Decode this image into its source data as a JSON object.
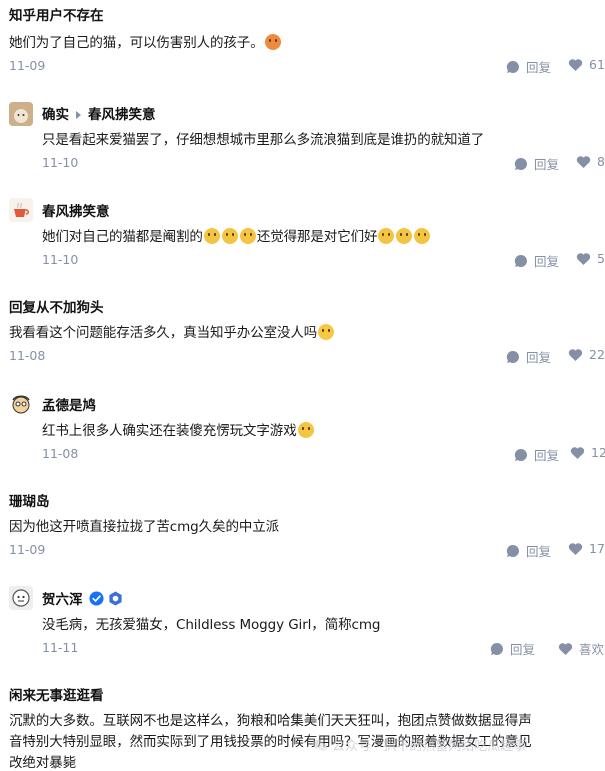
{
  "comments": [
    {
      "author": "知乎用户不存在",
      "text": "她们为了自己的猫，可以伤害别人的孩子。",
      "date": "11-09",
      "reply_label": "回复",
      "likes": "61"
    },
    {
      "author": "确实",
      "reply_to": "春风拂笑意",
      "text": "只是看起来爱猫罢了，仔细想想城市里那么多流浪猫到底是谁扔的就知道了",
      "date": "11-10",
      "reply_label": "回复",
      "likes": "8"
    },
    {
      "author": "春风拂笑意",
      "text_pre": "她们对自己的猫都是阉割的",
      "text_post": "还觉得那是对它们好",
      "date": "11-10",
      "reply_label": "回复",
      "likes": "5"
    },
    {
      "author": "回复从不加狗头",
      "text": "我看看这个问题能存活多久，真当知乎办公室没人吗",
      "date": "11-08",
      "reply_label": "回复",
      "likes": "22"
    },
    {
      "author": "孟德是鸠",
      "text": "红书上很多人确实还在装傻充愣玩文字游戏",
      "date": "11-08",
      "reply_label": "回复",
      "likes": "12"
    },
    {
      "author": "珊瑚岛",
      "text": "因为他这开喷直接拉拢了苦cmg久矣的中立派",
      "date": "11-09",
      "reply_label": "回复",
      "likes": "17"
    },
    {
      "author": "贺六浑",
      "text": "没毛病，无孩爱猫女，Childless Moggy Girl，简称cmg",
      "date": "11-11",
      "reply_label": "回复",
      "likes": "喜欢"
    },
    {
      "author": "闲来无事逛逛看",
      "text_line1": "沉默的大多数。互联网不也是这样么，狗粮和哈集美们天天狂叫，抱团点赞做数据显得声",
      "text_line2": "音特别大特别显眼，然而实际到了用钱投票的时候有用吗？写漫画的照着数据女工的意见",
      "text_line3": "改绝对暴毙"
    }
  ],
  "watermark": "公众号 · 扒不的热留网络吃瓜趣事",
  "colors": {
    "meta": "#8590a6",
    "text": "#1a1a1a",
    "verified": "#1772f6"
  }
}
